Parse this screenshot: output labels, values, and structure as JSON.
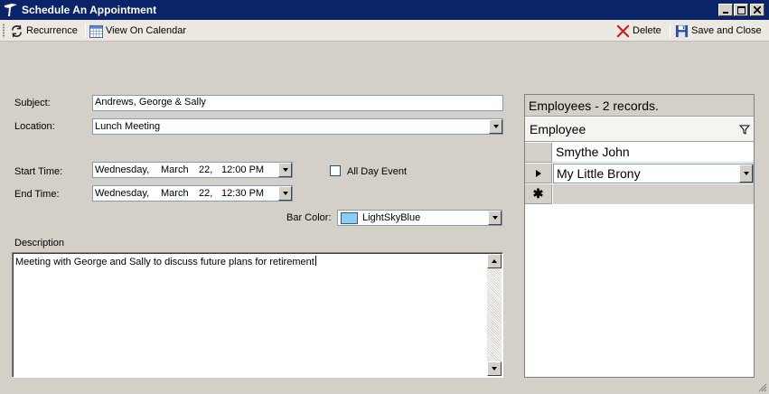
{
  "window": {
    "title": "Schedule An Appointment"
  },
  "toolbar": {
    "recurrence_label": "Recurrence",
    "view_calendar_label": "View On Calendar",
    "delete_label": "Delete",
    "save_close_label": "Save and Close"
  },
  "form": {
    "subject_label": "Subject:",
    "subject_value": "Andrews, George & Sally",
    "location_label": "Location:",
    "location_value": "Lunch Meeting",
    "start_label": "Start Time:",
    "start": {
      "weekday": "Wednesday,",
      "month": "March",
      "day": "22,",
      "time": "12:00 PM"
    },
    "end_label": "End Time:",
    "end": {
      "weekday": "Wednesday,",
      "month": "March",
      "day": "22,",
      "time": "12:30 PM"
    },
    "all_day_label": "All Day Event",
    "all_day_checked": false,
    "bar_color_label": "Bar Color:",
    "bar_color_value": "LightSkyBlue",
    "bar_color_hex": "#87cefa",
    "description_label": "Description",
    "description_value": "Meeting with George and Sally to discuss future plans for retirement"
  },
  "employees_grid": {
    "header": "Employees - 2 records.",
    "column": "Employee",
    "rows": [
      {
        "name": "Smythe John"
      },
      {
        "name": "My Little Brony"
      }
    ]
  },
  "icons": {
    "recurrence": "recurrence-icon",
    "calendar": "calendar-icon",
    "delete": "delete-x-icon",
    "save": "floppy-disk-icon",
    "filter": "filter-icon"
  },
  "colors": {
    "titlebar": "#0a246a",
    "window_bg": "#d4d0c8",
    "delete_red": "#cc2020"
  }
}
